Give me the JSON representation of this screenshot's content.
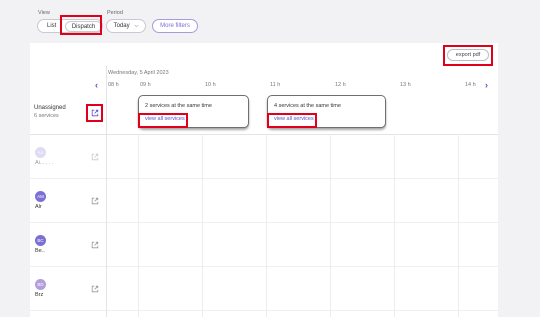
{
  "filters": {
    "view_label": "View",
    "view_options": [
      "List",
      "Dispatch"
    ],
    "period_label": "Period",
    "period_value": "Today",
    "more_filters_label": "More filters"
  },
  "toolbar": {
    "export_label": "export pdf"
  },
  "schedule": {
    "date": "Wednesday, 5 April 2023",
    "hours": [
      "08 h",
      "09 h",
      "10 h",
      "11 h",
      "12 h",
      "13 h",
      "14 h"
    ],
    "unassigned_title": "Unassigned",
    "unassigned_count": "6 services",
    "cards": [
      {
        "title": "2 services at the same time",
        "link": "view all services"
      },
      {
        "title": "4 services at the same time",
        "link": "view all services"
      }
    ]
  },
  "resources": [
    {
      "initials": "AA",
      "name": "Ai...  ,  .  .",
      "color": "#b8b3e8"
    },
    {
      "initials": "AM",
      "name": "Alr",
      "color": "#7b6fd6"
    },
    {
      "initials": "BC",
      "name": "Be..",
      "color": "#7b6fd6"
    },
    {
      "initials": "BD",
      "name": "Brz",
      "color": "#b39ddb"
    }
  ],
  "icons": {
    "external": "external-link-icon",
    "prev": "chevron-left-icon",
    "next": "chevron-right-icon",
    "dropdown": "chevron-down-icon"
  },
  "colors": {
    "accent": "#5b4fc4",
    "highlight": "#e0001b"
  }
}
